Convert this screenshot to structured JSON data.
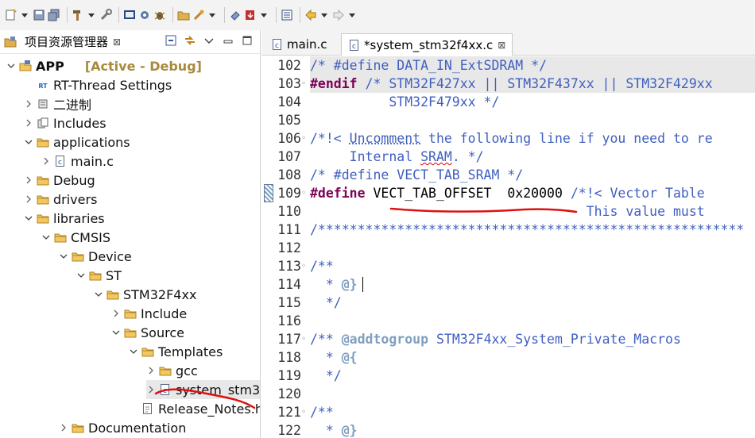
{
  "explorer": {
    "title": "项目资源管理器",
    "close_glyph": "⊠",
    "tree": [
      {
        "label": "APP",
        "extra": "[Active - Debug]",
        "depth": 0,
        "expanded": true,
        "icon": "project-icon"
      },
      {
        "label": "RT-Thread Settings",
        "depth": 1,
        "expanded": null,
        "icon": "rt-thread-icon"
      },
      {
        "label": "二进制",
        "depth": 1,
        "expanded": false,
        "icon": "binaries-icon"
      },
      {
        "label": "Includes",
        "depth": 1,
        "expanded": false,
        "icon": "includes-icon"
      },
      {
        "label": "applications",
        "depth": 1,
        "expanded": true,
        "icon": "folder-icon"
      },
      {
        "label": "main.c",
        "depth": 2,
        "expanded": false,
        "icon": "c-file-icon"
      },
      {
        "label": "Debug",
        "depth": 1,
        "expanded": false,
        "icon": "folder-icon"
      },
      {
        "label": "drivers",
        "depth": 1,
        "expanded": false,
        "icon": "folder-icon"
      },
      {
        "label": "libraries",
        "depth": 1,
        "expanded": true,
        "icon": "folder-icon"
      },
      {
        "label": "CMSIS",
        "depth": 2,
        "expanded": true,
        "icon": "folder-icon"
      },
      {
        "label": "Device",
        "depth": 3,
        "expanded": true,
        "icon": "folder-icon"
      },
      {
        "label": "ST",
        "depth": 4,
        "expanded": true,
        "icon": "folder-icon"
      },
      {
        "label": "STM32F4xx",
        "depth": 5,
        "expanded": true,
        "icon": "folder-icon"
      },
      {
        "label": "Include",
        "depth": 6,
        "expanded": false,
        "icon": "folder-icon"
      },
      {
        "label": "Source",
        "depth": 6,
        "expanded": true,
        "icon": "folder-icon"
      },
      {
        "label": "Templates",
        "depth": 7,
        "expanded": true,
        "icon": "folder-icon"
      },
      {
        "label": "gcc",
        "depth": 8,
        "expanded": false,
        "icon": "folder-icon"
      },
      {
        "label": "system_stm3",
        "depth": 8,
        "expanded": false,
        "icon": "c-file-icon",
        "selected": true
      },
      {
        "label": "Release_Notes.htm",
        "depth": 7,
        "expanded": null,
        "icon": "html-file-icon"
      },
      {
        "label": "Documentation",
        "depth": 3,
        "expanded": false,
        "icon": "folder-icon"
      }
    ]
  },
  "editor": {
    "tabs": [
      {
        "label": "main.c",
        "active": false
      },
      {
        "label": "*system_stm32f4xx.c",
        "active": true
      }
    ],
    "tab_close_glyph": "⊠",
    "lines": [
      {
        "n": "102",
        "fold": "",
        "hl": true,
        "segs": [
          [
            "cm",
            "/* #define DATA_IN_ExtSDRAM */"
          ]
        ]
      },
      {
        "n": "103",
        "fold": "◦",
        "hl": true,
        "segs": [
          [
            "kw",
            "#endif"
          ],
          [
            "mac",
            " "
          ],
          [
            "cm",
            "/* STM32F427xx || STM32F437xx || STM32F429xx"
          ]
        ]
      },
      {
        "n": "104",
        "fold": "",
        "hl": false,
        "segs": [
          [
            "cm",
            "          STM32F479xx */"
          ]
        ]
      },
      {
        "n": "105",
        "fold": "",
        "hl": false,
        "segs": []
      },
      {
        "n": "106",
        "fold": "◦",
        "hl": false,
        "segs": [
          [
            "cm",
            "/*!< "
          ],
          [
            "cm dotted",
            "Uncomment"
          ],
          [
            "cm",
            " the following line if you need to re"
          ]
        ]
      },
      {
        "n": "107",
        "fold": "",
        "hl": false,
        "segs": [
          [
            "cm",
            "     Internal "
          ],
          [
            "cm squig",
            "SRAM"
          ],
          [
            "cm",
            ". */"
          ]
        ]
      },
      {
        "n": "108",
        "fold": "",
        "hl": false,
        "segs": [
          [
            "cm",
            "/* #define VECT_TAB_SRAM */"
          ]
        ]
      },
      {
        "n": "109",
        "fold": "◦",
        "hl": false,
        "segs": [
          [
            "kw",
            "#define"
          ],
          [
            "mac",
            " VECT_TAB_OFFSET  0x20000 "
          ],
          [
            "cm",
            "/*!< Vector Table"
          ]
        ]
      },
      {
        "n": "110",
        "fold": "",
        "hl": false,
        "segs": [
          [
            "cm",
            "                                   This value must"
          ]
        ]
      },
      {
        "n": "111",
        "fold": "",
        "hl": false,
        "segs": [
          [
            "cm",
            "/******************************************************"
          ]
        ]
      },
      {
        "n": "112",
        "fold": "",
        "hl": false,
        "segs": []
      },
      {
        "n": "113",
        "fold": "◦",
        "hl": false,
        "segs": [
          [
            "cm",
            "/**"
          ]
        ]
      },
      {
        "n": "114",
        "fold": "",
        "hl": false,
        "segs": [
          [
            "cm",
            "  * "
          ],
          [
            "tag",
            "@}"
          ]
        ]
      },
      {
        "n": "115",
        "fold": "",
        "hl": false,
        "segs": [
          [
            "cm",
            "  */"
          ]
        ]
      },
      {
        "n": "116",
        "fold": "",
        "hl": false,
        "segs": []
      },
      {
        "n": "117",
        "fold": "◦",
        "hl": false,
        "segs": [
          [
            "cm",
            "/** "
          ],
          [
            "tag",
            "@addtogroup"
          ],
          [
            "cm",
            " STM32F4xx_System_Private_Macros"
          ]
        ]
      },
      {
        "n": "118",
        "fold": "",
        "hl": false,
        "segs": [
          [
            "cm",
            "  * "
          ],
          [
            "tag",
            "@{"
          ]
        ]
      },
      {
        "n": "119",
        "fold": "",
        "hl": false,
        "segs": [
          [
            "cm",
            "  */"
          ]
        ]
      },
      {
        "n": "120",
        "fold": "",
        "hl": false,
        "segs": []
      },
      {
        "n": "121",
        "fold": "◦",
        "hl": false,
        "segs": [
          [
            "cm",
            "/**"
          ]
        ]
      },
      {
        "n": "122",
        "fold": "",
        "hl": false,
        "segs": [
          [
            "cm",
            "  * "
          ],
          [
            "tag",
            "@}"
          ]
        ]
      }
    ]
  }
}
